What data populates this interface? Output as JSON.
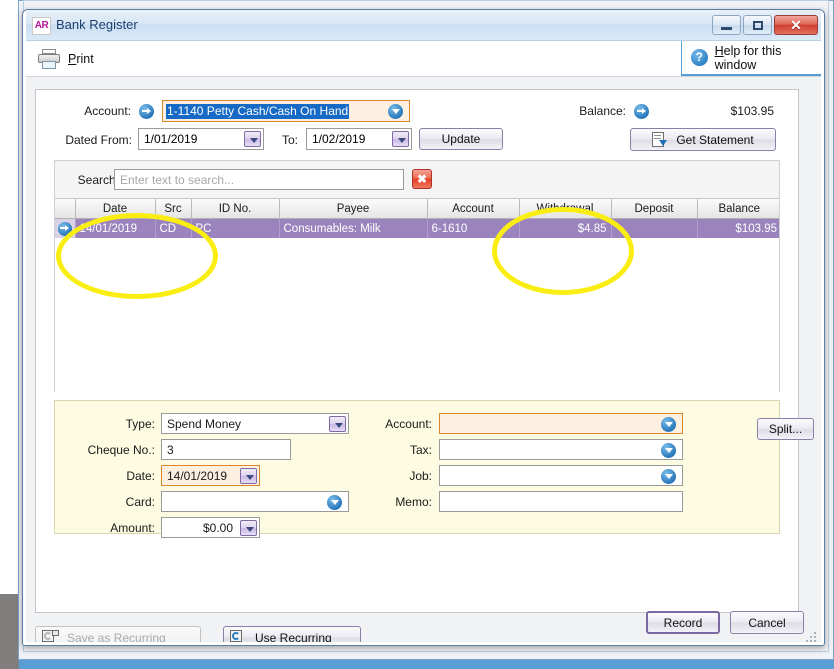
{
  "window": {
    "title": "Bank Register",
    "app_badge": "AR",
    "controls": {
      "minimize": "minimize-icon",
      "maximize": "maximize-icon",
      "close": "✕"
    }
  },
  "toolbar": {
    "print_label_prefix": "",
    "print_accel": "P",
    "print_label": "rint",
    "print_full": "Print",
    "help_accel": "H",
    "help_label": "elp for this window",
    "help_full": "Help for this window",
    "help_icon": "?"
  },
  "account_row": {
    "label": "Account:",
    "value": "1-1140 Petty Cash/Cash On Hand",
    "selected": true
  },
  "balance": {
    "label": "Balance:",
    "value": "$103.95"
  },
  "date_range": {
    "from_label": "Dated From:",
    "from_value": "1/01/2019",
    "to_label": "To:",
    "to_value": "1/02/2019",
    "update_label": "Update"
  },
  "get_statement": {
    "label": "Get Statement"
  },
  "search": {
    "label": "Search:",
    "value": "",
    "placeholder": "Enter text to search...",
    "clear_label": "✖"
  },
  "register_table": {
    "columns": [
      "",
      "Date",
      "Src",
      "ID No.",
      "Payee",
      "Account",
      "Withdrawal",
      "Deposit",
      "Balance"
    ],
    "rows": [
      {
        "selected": true,
        "marker": "row-indicator-arrow",
        "date": "14/01/2019",
        "src": "CD",
        "id_no": "PC",
        "payee": "Consumables: Milk",
        "account": "6-1610",
        "withdrawal": "$4.85",
        "deposit": "",
        "balance": "$103.95"
      }
    ]
  },
  "entry_form": {
    "type_label": "Type:",
    "type_value": "Spend Money",
    "cheque_label": "Cheque No.:",
    "cheque_value": "3",
    "date_label": "Date:",
    "date_value": "14/01/2019",
    "card_label": "Card:",
    "card_value": "",
    "amount_label": "Amount:",
    "amount_value": "$0.00",
    "account_label": "Account:",
    "account_value": "",
    "tax_label": "Tax:",
    "tax_value": "",
    "job_label": "Job:",
    "job_value": "",
    "memo_label": "Memo:",
    "memo_value": "",
    "split_label": "Split..."
  },
  "recurring": {
    "save_label": "Save as Recurring",
    "save_disabled": true,
    "use_label": "Use Recurring"
  },
  "footer": {
    "record_label": "Record",
    "cancel_label": "Cancel"
  },
  "annotations": [
    {
      "name": "date-column-highlight",
      "color": "#faed12"
    },
    {
      "name": "withdrawal-column-highlight",
      "color": "#faed12"
    }
  ],
  "colors": {
    "selected_row": "#9b84bd",
    "focus_field": "#fdf0e0",
    "focus_border": "#d98829",
    "annotation": "#faed12",
    "form_panel": "#fdfbe2",
    "help_accent": "#5a9fd4"
  }
}
